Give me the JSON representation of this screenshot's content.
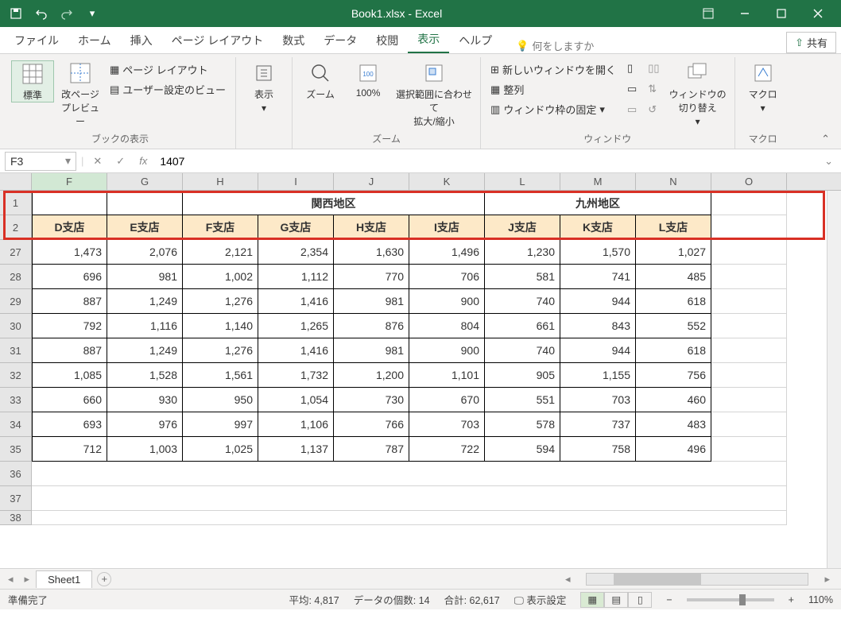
{
  "app": {
    "title": "Book1.xlsx  -  Excel"
  },
  "tabs": {
    "file": "ファイル",
    "home": "ホーム",
    "insert": "挿入",
    "layout": "ページ レイアウト",
    "formula": "数式",
    "data": "データ",
    "review": "校閲",
    "view": "表示",
    "help": "ヘルプ",
    "search": "何をしますか",
    "share": "共有"
  },
  "ribbon": {
    "wb_views": {
      "normal": "標準",
      "page_break": "改ページ\nプレビュー",
      "page_layout": "ページ レイアウト",
      "custom": "ユーザー設定のビュー",
      "group": "ブックの表示"
    },
    "show": {
      "label": "表示",
      "group": ""
    },
    "zoom": {
      "zoom": "ズーム",
      "z100": "100%",
      "sel": "選択範囲に合わせて\n拡大/縮小",
      "group": "ズーム"
    },
    "window": {
      "new": "新しいウィンドウを開く",
      "arrange": "整列",
      "freeze": "ウィンドウ枠の固定",
      "switch": "ウィンドウの\n切り替え",
      "group": "ウィンドウ"
    },
    "macro": {
      "label": "マクロ",
      "group": "マクロ"
    }
  },
  "fbar": {
    "name": "F3",
    "value": "1407"
  },
  "cols": [
    "F",
    "G",
    "H",
    "I",
    "J",
    "K",
    "L",
    "M",
    "N",
    "O"
  ],
  "rownums": [
    "1",
    "2",
    "27",
    "28",
    "29",
    "30",
    "31",
    "32",
    "33",
    "34",
    "35",
    "36",
    "37",
    "38"
  ],
  "hdr1": {
    "kansai": "関西地区",
    "kyushu": "九州地区"
  },
  "hdr2": [
    "D支店",
    "E支店",
    "F支店",
    "G支店",
    "H支店",
    "I支店",
    "J支店",
    "K支店",
    "L支店"
  ],
  "data": [
    [
      "1,473",
      "2,076",
      "2,121",
      "2,354",
      "1,630",
      "1,496",
      "1,230",
      "1,570",
      "1,027"
    ],
    [
      "696",
      "981",
      "1,002",
      "1,112",
      "770",
      "706",
      "581",
      "741",
      "485"
    ],
    [
      "887",
      "1,249",
      "1,276",
      "1,416",
      "981",
      "900",
      "740",
      "944",
      "618"
    ],
    [
      "792",
      "1,116",
      "1,140",
      "1,265",
      "876",
      "804",
      "661",
      "843",
      "552"
    ],
    [
      "887",
      "1,249",
      "1,276",
      "1,416",
      "981",
      "900",
      "740",
      "944",
      "618"
    ],
    [
      "1,085",
      "1,528",
      "1,561",
      "1,732",
      "1,200",
      "1,101",
      "905",
      "1,155",
      "756"
    ],
    [
      "660",
      "930",
      "950",
      "1,054",
      "730",
      "670",
      "551",
      "703",
      "460"
    ],
    [
      "693",
      "976",
      "997",
      "1,106",
      "766",
      "703",
      "578",
      "737",
      "483"
    ],
    [
      "712",
      "1,003",
      "1,025",
      "1,137",
      "787",
      "722",
      "594",
      "758",
      "496"
    ]
  ],
  "sheet": {
    "s1": "Sheet1"
  },
  "status": {
    "ready": "準備完了",
    "avg": "平均: 4,817",
    "count": "データの個数: 14",
    "sum": "合計: 62,617",
    "disp": "表示設定",
    "zoom": "110%"
  }
}
